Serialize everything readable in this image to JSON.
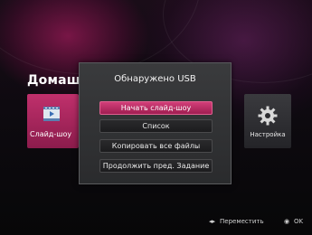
{
  "home": {
    "title": "Домашн"
  },
  "tiles": [
    {
      "label": "Слайд-шоу",
      "icon": "film-icon"
    },
    {
      "label": "Настройка",
      "icon": "gear-icon"
    }
  ],
  "dialog": {
    "title": "Обнаружено USB",
    "buttons": [
      {
        "label": "Начать слайд-шоу",
        "selected": true
      },
      {
        "label": "Список",
        "selected": false
      },
      {
        "label": "Копировать все файлы",
        "selected": false
      },
      {
        "label": "Продолжить пред. Задание",
        "selected": false
      }
    ]
  },
  "footer": {
    "move_symbol": "◂▸",
    "move_label": "Переместить",
    "ok_symbol": "◉",
    "ok_label": "OK"
  },
  "colors": {
    "accent": "#c42a68",
    "dialog_bg": "#323335"
  }
}
